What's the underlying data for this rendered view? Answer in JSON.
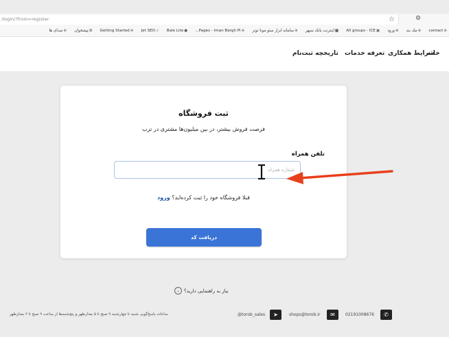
{
  "browser": {
    "url": "/login/?from=register",
    "bookmarks": [
      "contact",
      "مک بند",
      "ورود",
      "All groups - ICE",
      "اینترنت بانک سپهر",
      "سامانه ابزار سئو مونا تونز",
      "Pages - Iman Bargh Pi...",
      "Bale Lite",
      "Jet SEO",
      "Getting Started",
      "پیشخوان",
      "صدای ها"
    ]
  },
  "nav": {
    "home": "خانه",
    "cooperation": "شرایط همکاری",
    "pricing": "تعرفه خدمات",
    "history": "تاریخچه ثبت‌نام"
  },
  "form": {
    "title": "ثبت فروشگاه",
    "subtitle": "فرصت فروش بیشتر، در بین میلیون‌ها مشتری در ترب",
    "phone_label": "تلفن همراه",
    "phone_placeholder": "شماره همراه",
    "already_registered": "قبلا فروشگاه خود را ثبت کرده‌اید؟",
    "login_link": "ورود",
    "submit_label": "دریافت کد"
  },
  "footer": {
    "help_text": "نیاز به راهنمایی دارید؟",
    "phone": "02191008676",
    "email": "shops@torob.ir",
    "telegram": "@torob_sales",
    "hours": "ساعات پاسخ‌گویی شنبه تا چهارشنبه ۹ صبح تا ۵ بعدازظهر و پنج‌شنبه‌ها از ساعت ۹ صبح تا ۲ بعدازظهر"
  },
  "colors": {
    "primary_button": "#3a74d6",
    "login_link": "#1c4fa7",
    "annotation_arrow": "#e8401c"
  }
}
